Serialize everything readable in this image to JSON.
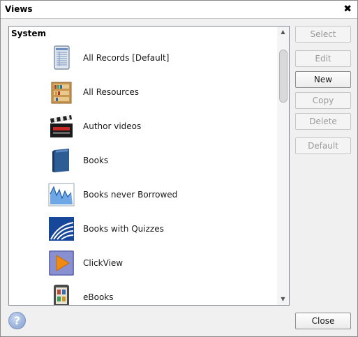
{
  "window": {
    "title": "Views"
  },
  "list": {
    "group_header": "System",
    "items": [
      {
        "label": "All Records [Default]",
        "icon": "records-icon"
      },
      {
        "label": "All Resources",
        "icon": "bookshelf-icon"
      },
      {
        "label": "Author videos",
        "icon": "clapperboard-icon"
      },
      {
        "label": "Books",
        "icon": "book-icon"
      },
      {
        "label": "Books never Borrowed",
        "icon": "chart-icon"
      },
      {
        "label": "Books with Quizzes",
        "icon": "quiz-icon"
      },
      {
        "label": "ClickView",
        "icon": "play-icon"
      },
      {
        "label": "eBooks",
        "icon": "ereader-icon"
      }
    ]
  },
  "buttons": {
    "select": "Select",
    "edit": "Edit",
    "new": "New",
    "copy": "Copy",
    "delete": "Delete",
    "default": "Default",
    "close": "Close"
  },
  "help": {
    "symbol": "?"
  },
  "colors": {
    "window_bg": "#f0f0f0",
    "list_bg": "#ffffff",
    "disabled_text": "#9a9a9a",
    "help_blue": "#7e9ccc"
  }
}
